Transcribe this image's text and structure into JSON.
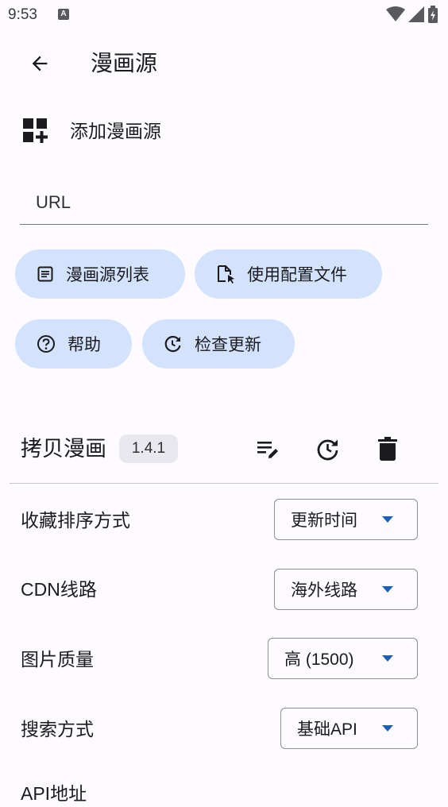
{
  "status_bar": {
    "time": "9:53",
    "notification_glyph": "A"
  },
  "app_bar": {
    "title": "漫画源",
    "back_icon": "arrow-left-icon"
  },
  "add_section": {
    "label": "添加漫画源",
    "icon": "widgets-add-icon"
  },
  "url_field": {
    "placeholder": "URL",
    "value": ""
  },
  "actions": [
    {
      "label": "漫画源列表",
      "icon": "list-icon"
    },
    {
      "label": "使用配置文件",
      "icon": "file-cursor-icon"
    },
    {
      "label": "帮助",
      "icon": "help-circle-icon"
    },
    {
      "label": "检查更新",
      "icon": "refresh-icon"
    }
  ],
  "source": {
    "name": "拷贝漫画",
    "version": "1.4.1",
    "settings": [
      {
        "label": "收藏排序方式",
        "value": "更新时间"
      },
      {
        "label": "CDN线路",
        "value": "海外线路"
      },
      {
        "label": "图片质量",
        "value": "高 (1500)"
      },
      {
        "label": "搜索方式",
        "value": "基础API"
      },
      {
        "label": "API地址"
      }
    ]
  },
  "colors": {
    "accent": "#1a5fb4",
    "chip_bg": "#d3e3fd",
    "background": "#fdfbff"
  }
}
